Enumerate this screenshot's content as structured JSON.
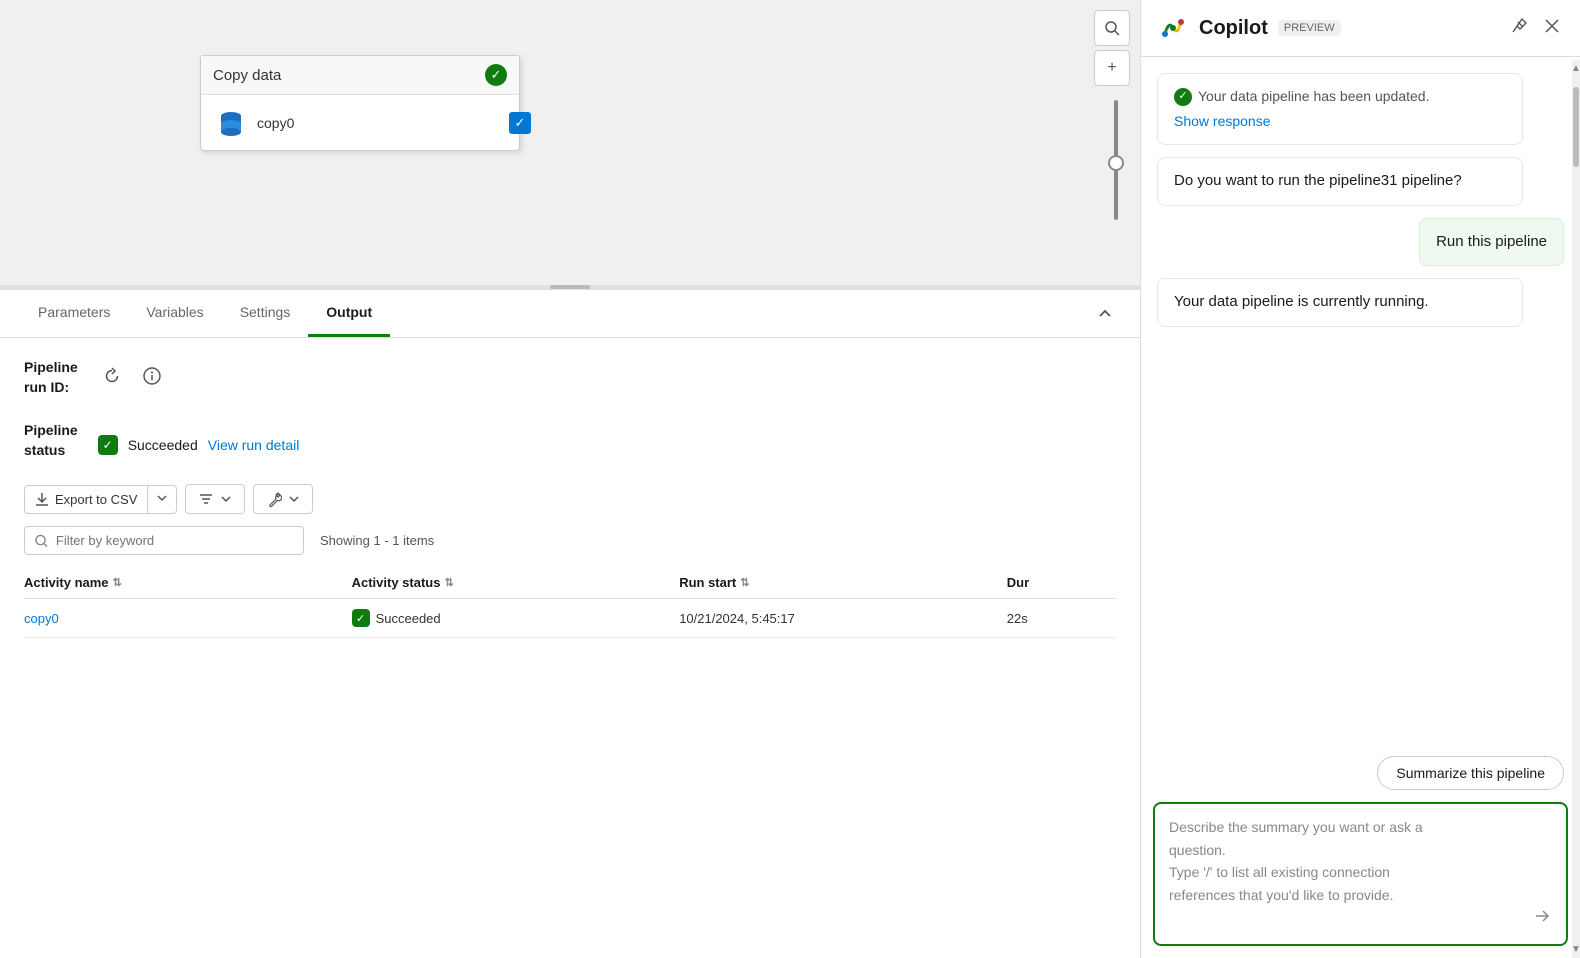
{
  "canvas": {
    "node_title": "Copy data",
    "node_activity": "copy0",
    "zoom_search_label": "search",
    "zoom_add_label": "add"
  },
  "tabs": {
    "items": [
      {
        "label": "Parameters",
        "active": false
      },
      {
        "label": "Variables",
        "active": false
      },
      {
        "label": "Settings",
        "active": false
      },
      {
        "label": "Output",
        "active": true
      }
    ],
    "collapse_label": "^"
  },
  "output": {
    "pipeline_run_id_label": "Pipeline\nrun ID:",
    "pipeline_status_label": "Pipeline\nstatus",
    "status_value": "Succeeded",
    "view_run_detail_label": "View run detail",
    "export_csv_label": "Export to CSV",
    "filter_placeholder": "Filter by keyword",
    "showing_text": "Showing 1 - 1 items",
    "table": {
      "columns": [
        {
          "label": "Activity name"
        },
        {
          "label": "Activity status"
        },
        {
          "label": "Run start"
        },
        {
          "label": "Dur"
        }
      ],
      "rows": [
        {
          "activity_name": "copy0",
          "activity_status": "Succeeded",
          "run_start": "10/21/2024, 5:45:17",
          "duration": "22s"
        }
      ]
    }
  },
  "copilot": {
    "title": "Copilot",
    "preview_badge": "PREVIEW",
    "messages": [
      {
        "type": "ai_update",
        "update_text": "Your data pipeline has been updated.",
        "show_response_label": "Show response"
      },
      {
        "type": "ai",
        "text": "Do you want to run the pipeline31 pipeline?"
      },
      {
        "type": "user",
        "text": "Run this pipeline"
      },
      {
        "type": "ai",
        "text": "Your data pipeline is currently running."
      }
    ],
    "suggestions": [
      {
        "label": "Summarize this pipeline"
      }
    ],
    "input_placeholder_line1": "Describe the summary you want or ask a",
    "input_placeholder_line2": "question.",
    "input_placeholder_line3": "Type '/' to list all existing connection",
    "input_placeholder_line4": "references that you'd like to provide."
  }
}
